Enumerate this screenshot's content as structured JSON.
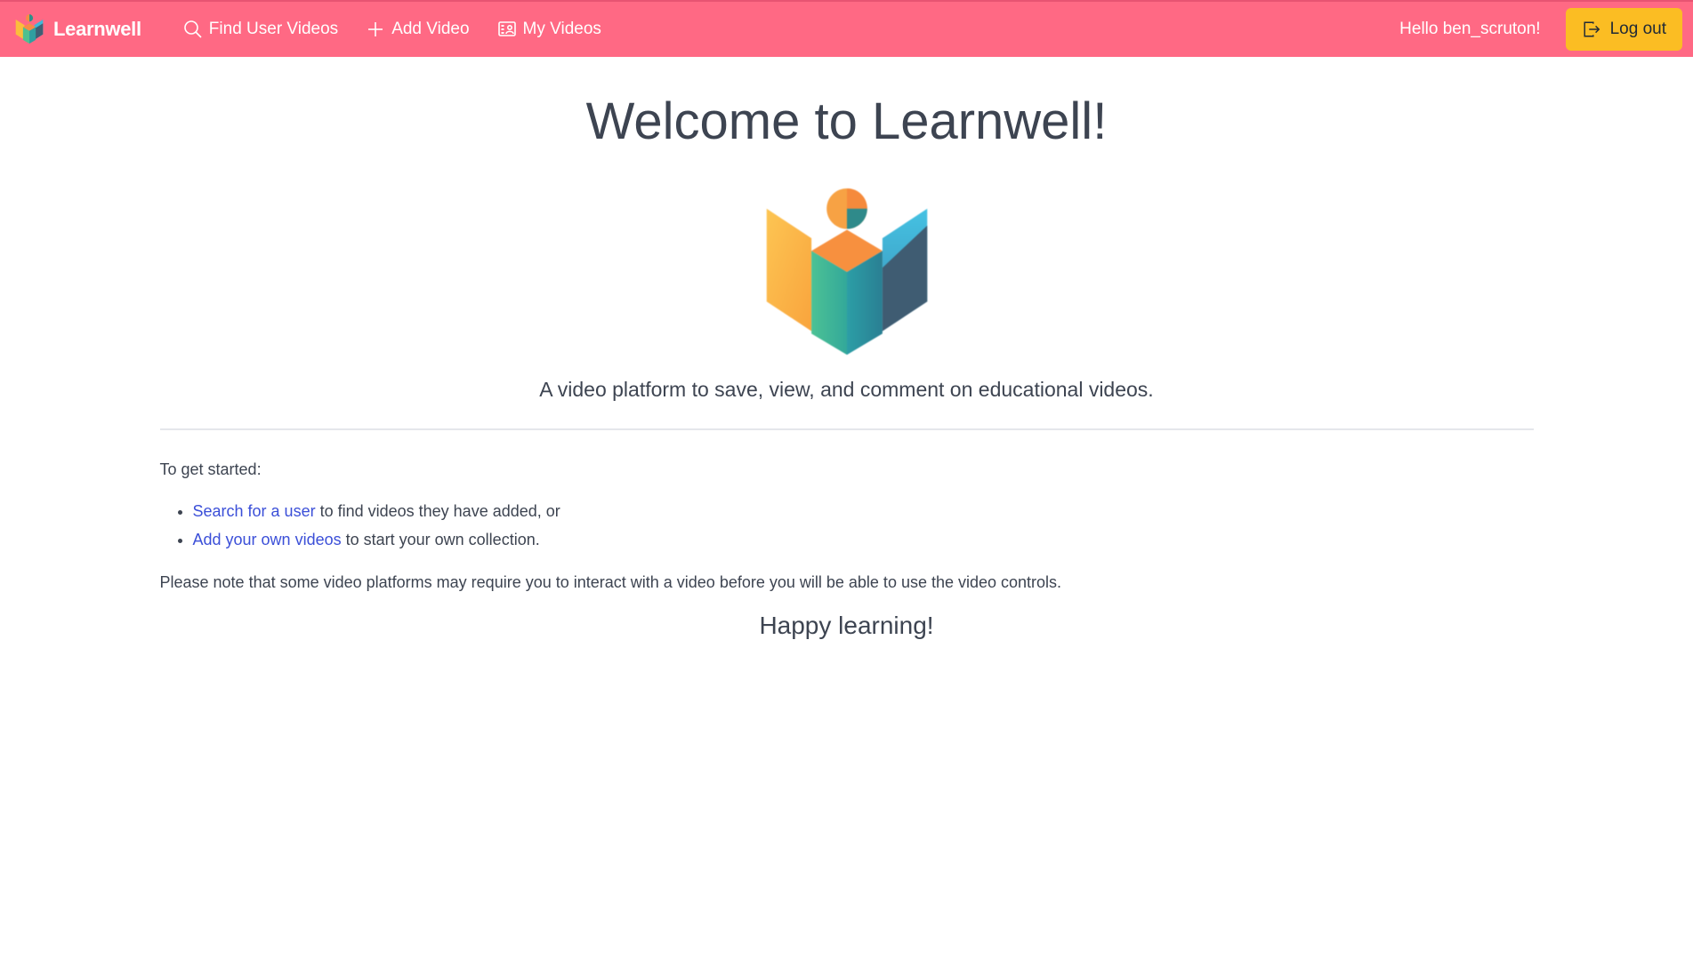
{
  "navbar": {
    "brand": "Learnwell",
    "items": [
      {
        "label": "Find User Videos",
        "icon": "search-icon"
      },
      {
        "label": "Add Video",
        "icon": "plus-icon"
      },
      {
        "label": "My Videos",
        "icon": "video-library-icon"
      }
    ],
    "greeting": "Hello ben_scruton!",
    "logout_label": "Log out",
    "logout_icon": "logout-icon"
  },
  "main": {
    "title": "Welcome to Learnwell!",
    "tagline": "A video platform to save, view, and comment on educational videos.",
    "intro": "To get started:",
    "steps": [
      {
        "link": "Search for a user",
        "text": " to find videos they have added, or"
      },
      {
        "link": "Add your own videos",
        "text": " to start your own collection."
      }
    ],
    "note": "Please note that some video platforms may require you to interact with a video before you will be able to use the video controls.",
    "closing": "Happy learning!"
  },
  "colors": {
    "navbar": "#ff6984",
    "logout_button": "#fbbd23",
    "link": "#3b4fd8",
    "text": "#3d4451"
  }
}
